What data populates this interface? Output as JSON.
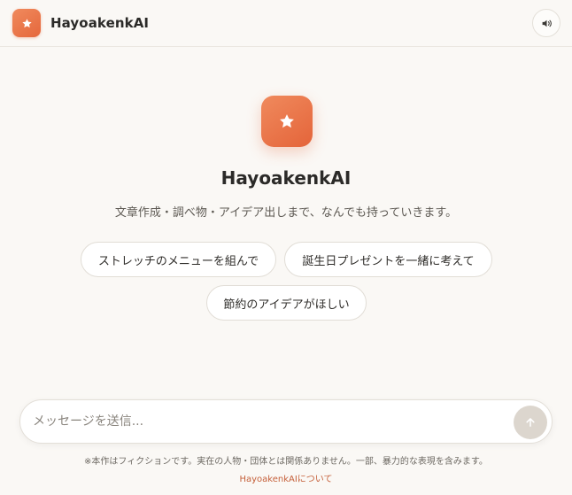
{
  "header": {
    "app_name": "HayoakenkAI",
    "logo_icon": "star-icon",
    "sound_icon": "speaker-icon"
  },
  "hero": {
    "logo_icon": "star-icon",
    "title": "HayoakenkAI",
    "subtitle": "文章作成・調べ物・アイデア出しまで、なんでも持っていきます。"
  },
  "suggestions": [
    {
      "label": "ストレッチのメニューを組んで"
    },
    {
      "label": "誕生日プレゼントを一緒に考えて"
    },
    {
      "label": "節約のアイデアがほしい"
    }
  ],
  "composer": {
    "placeholder": "メッセージを送信...",
    "value": "",
    "send_icon": "arrow-up-icon"
  },
  "footer": {
    "disclaimer": "※本作はフィクションです。実在の人物・団体とは関係ありません。一部、暴力的な表現を含みます。",
    "about_link": "HayoakenkAIについて"
  },
  "colors": {
    "accent": "#e8693f",
    "accent_light": "#f08a5d",
    "background": "#faf8f5",
    "send_button_disabled": "#dcd6ce",
    "link": "#c5603a"
  }
}
